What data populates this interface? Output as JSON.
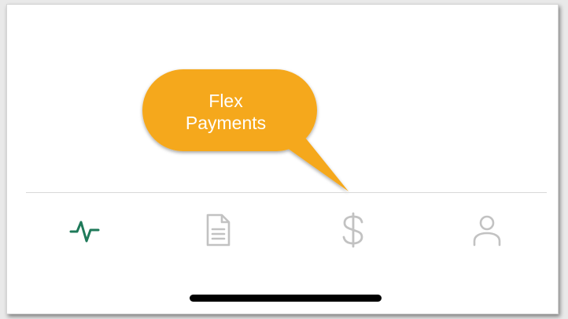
{
  "tooltip": {
    "text": "Flex\nPayments",
    "color": "#F5A81C"
  },
  "tabbar": {
    "items": [
      {
        "id": "activity",
        "icon": "activity-pulse-icon",
        "active": true
      },
      {
        "id": "documents",
        "icon": "document-icon",
        "active": false
      },
      {
        "id": "payments",
        "icon": "dollar-icon",
        "active": false
      },
      {
        "id": "profile",
        "icon": "user-icon",
        "active": false
      }
    ],
    "active_color": "#1F7A5A",
    "inactive_color": "#C2C2C2"
  },
  "home_indicator": {
    "color": "#000000"
  }
}
